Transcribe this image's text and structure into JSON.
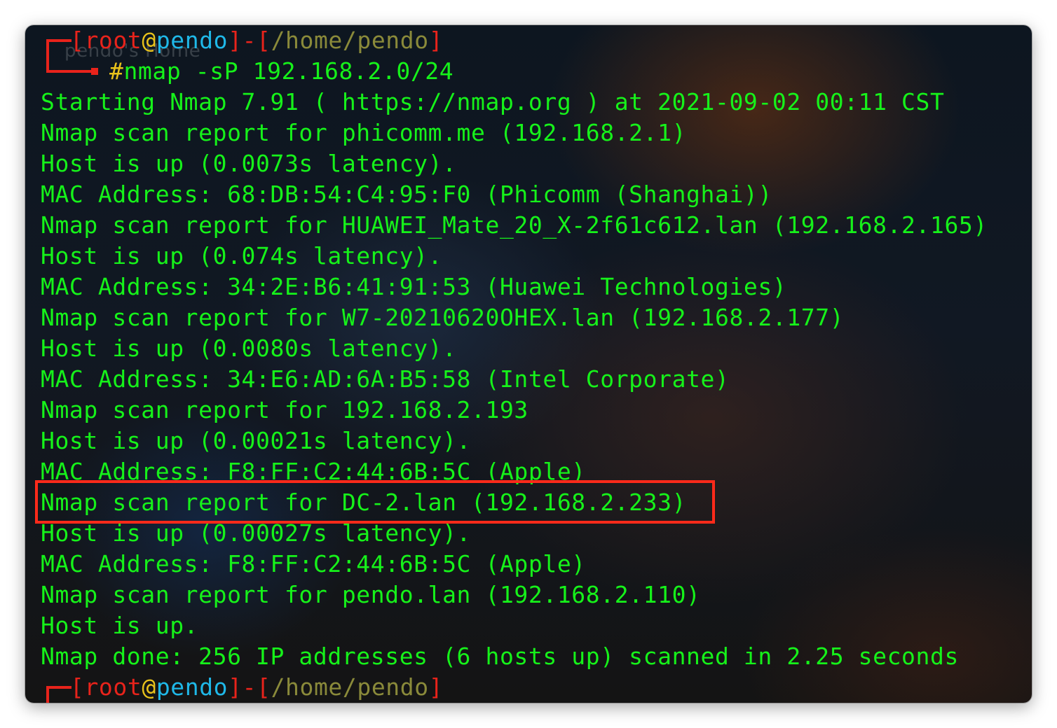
{
  "watermark": "pendo's Home",
  "prompt_top": {
    "user": "root",
    "at": "@",
    "host": "pendo",
    "path": "/home/pendo"
  },
  "command": {
    "prompt_char": "#",
    "text": "nmap -sP 192.168.2.0/24"
  },
  "output": [
    "Starting Nmap 7.91 ( https://nmap.org ) at 2021-09-02 00:11 CST",
    "Nmap scan report for phicomm.me (192.168.2.1)",
    "Host is up (0.0073s latency).",
    "MAC Address: 68:DB:54:C4:95:F0 (Phicomm (Shanghai))",
    "Nmap scan report for HUAWEI_Mate_20_X-2f61c612.lan (192.168.2.165)",
    "Host is up (0.074s latency).",
    "MAC Address: 34:2E:B6:41:91:53 (Huawei Technologies)",
    "Nmap scan report for W7-20210620OHEX.lan (192.168.2.177)",
    "Host is up (0.0080s latency).",
    "MAC Address: 34:E6:AD:6A:B5:58 (Intel Corporate)",
    "Nmap scan report for 192.168.2.193",
    "Host is up (0.00021s latency).",
    "MAC Address: F8:FF:C2:44:6B:5C (Apple)",
    "Nmap scan report for DC-2.lan (192.168.2.233)",
    "Host is up (0.00027s latency).",
    "MAC Address: F8:FF:C2:44:6B:5C (Apple)",
    "Nmap scan report for pendo.lan (192.168.2.110)",
    "Host is up.",
    "Nmap done: 256 IP addresses (6 hosts up) scanned in 2.25 seconds"
  ],
  "prompt_bottom": {
    "user": "root",
    "at": "@",
    "host": "pendo",
    "path": "/home/pendo"
  },
  "colors": {
    "output_text": "#16f21a",
    "prompt_red": "#e8231b",
    "prompt_at": "#e8c21b",
    "prompt_host": "#1fb8e8",
    "prompt_path": "#8a8a3a",
    "highlight_box": "#ff2a1a"
  }
}
